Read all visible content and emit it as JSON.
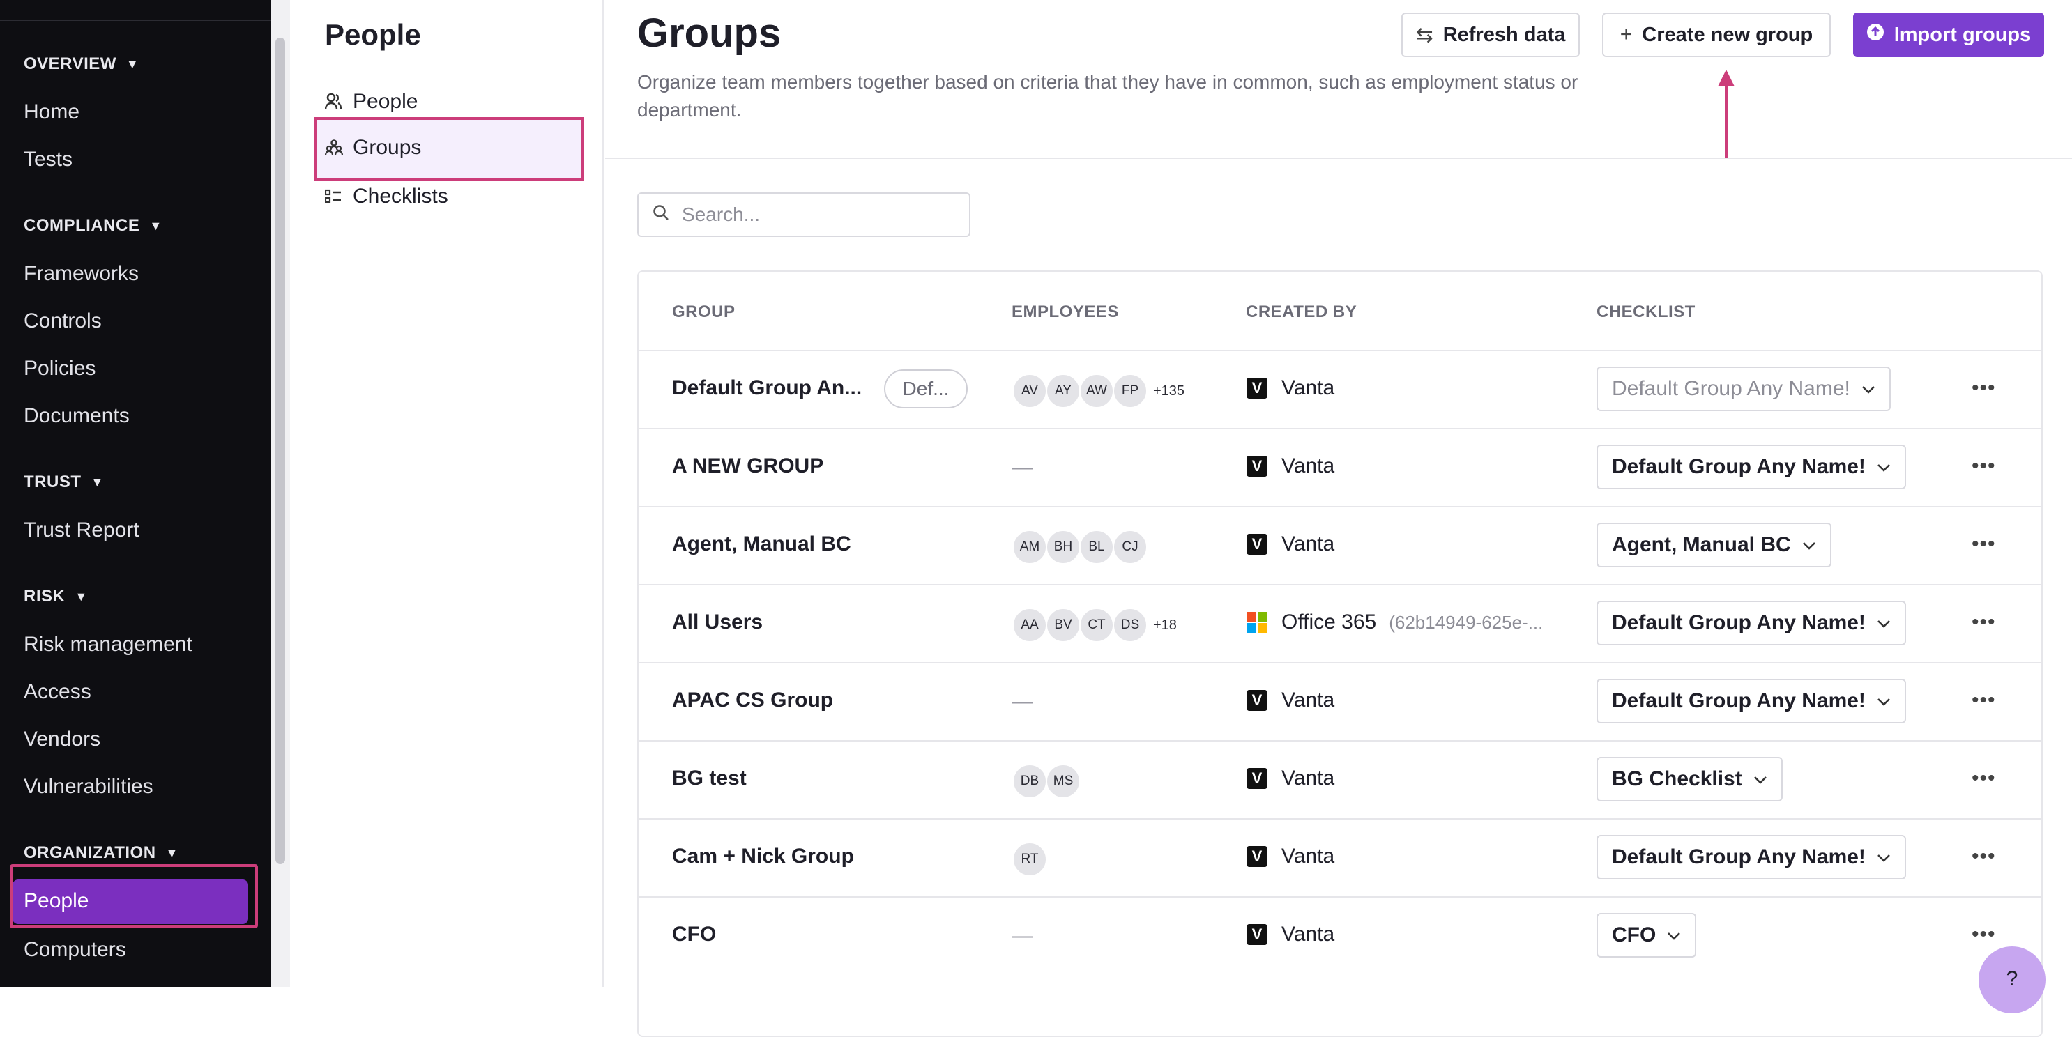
{
  "sidebar": {
    "sections": [
      {
        "label": "OVERVIEW",
        "items": [
          "Home",
          "Tests"
        ]
      },
      {
        "label": "COMPLIANCE",
        "items": [
          "Frameworks",
          "Controls",
          "Policies",
          "Documents"
        ]
      },
      {
        "label": "TRUST",
        "items": [
          "Trust Report"
        ]
      },
      {
        "label": "RISK",
        "items": [
          "Risk management",
          "Access",
          "Vendors",
          "Vulnerabilities"
        ]
      },
      {
        "label": "ORGANIZATION",
        "items": [
          "People",
          "Computers"
        ]
      }
    ],
    "active_item": "People"
  },
  "subnav": {
    "title": "People",
    "items": [
      {
        "label": "People",
        "icon": "people-icon"
      },
      {
        "label": "Groups",
        "icon": "groups-icon"
      },
      {
        "label": "Checklists",
        "icon": "checklist-icon"
      }
    ],
    "active_item": "Groups"
  },
  "header": {
    "title": "Groups",
    "description": "Organize team members together based on criteria that they have in common, such as employment status or department.",
    "refresh_label": "Refresh data",
    "create_label": "Create new group",
    "import_label": "Import groups"
  },
  "search": {
    "placeholder": "Search..."
  },
  "table": {
    "columns": [
      "GROUP",
      "EMPLOYEES",
      "CREATED BY",
      "CHECKLIST"
    ],
    "rows": [
      {
        "group": "Default Group An...",
        "tag": "Def...",
        "employees": [
          "AV",
          "AY",
          "AW",
          "FP"
        ],
        "more": "+135",
        "creator": "Vanta",
        "creator_logo": "vanta",
        "creator_id": "",
        "checklist": "Default Group Any Name!",
        "checklist_muted": true
      },
      {
        "group": "A NEW GROUP",
        "tag": "",
        "employees": [],
        "more": "",
        "empty": "—",
        "creator": "Vanta",
        "creator_logo": "vanta",
        "creator_id": "",
        "checklist": "Default Group Any Name!",
        "checklist_muted": false
      },
      {
        "group": "Agent, Manual BC",
        "tag": "",
        "employees": [
          "AM",
          "BH",
          "BL",
          "CJ"
        ],
        "more": "",
        "creator": "Vanta",
        "creator_logo": "vanta",
        "creator_id": "",
        "checklist": "Agent, Manual BC",
        "checklist_muted": false
      },
      {
        "group": "All Users",
        "tag": "",
        "employees": [
          "AA",
          "BV",
          "CT",
          "DS"
        ],
        "more": "+18",
        "creator": "Office 365",
        "creator_logo": "office365",
        "creator_id": "(62b14949-625e-...",
        "checklist": "Default Group Any Name!",
        "checklist_muted": false
      },
      {
        "group": "APAC CS Group",
        "tag": "",
        "employees": [],
        "more": "",
        "empty": "—",
        "creator": "Vanta",
        "creator_logo": "vanta",
        "creator_id": "",
        "checklist": "Default Group Any Name!",
        "checklist_muted": false
      },
      {
        "group": "BG test",
        "tag": "",
        "employees": [
          "DB",
          "MS"
        ],
        "more": "",
        "creator": "Vanta",
        "creator_logo": "vanta",
        "creator_id": "",
        "checklist": "BG Checklist",
        "checklist_muted": false
      },
      {
        "group": "Cam + Nick Group",
        "tag": "",
        "employees": [
          "RT"
        ],
        "more": "",
        "creator": "Vanta",
        "creator_logo": "vanta",
        "creator_id": "",
        "checklist": "Default Group Any Name!",
        "checklist_muted": false
      },
      {
        "group": "CFO",
        "tag": "",
        "employees": [],
        "more": "",
        "empty": "—",
        "creator": "Vanta",
        "creator_logo": "vanta",
        "creator_id": "",
        "checklist": "CFO",
        "checklist_muted": false
      }
    ]
  },
  "colors": {
    "accent": "#7b3fd0",
    "active_nav": "#7b2fbf",
    "highlight": "#cc3d7a"
  }
}
